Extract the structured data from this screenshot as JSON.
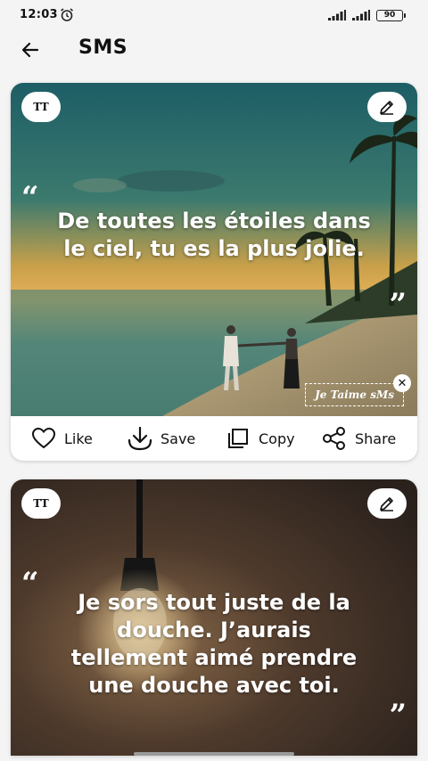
{
  "status_bar": {
    "time": "12:03",
    "battery": "90",
    "icons": [
      "alarm-icon",
      "signal-icon",
      "signal-icon",
      "battery-icon"
    ]
  },
  "header": {
    "title": "SMS",
    "back_icon": "back-arrow-icon"
  },
  "cards": [
    {
      "font_button": "TT",
      "quote_open": "“",
      "quote_close": "”",
      "text": "De toutes les étoiles dans le ciel, tu es la plus jolie.",
      "watermark": "Je Taime sMs",
      "watermark_close": "✕",
      "actions": {
        "like": "Like",
        "save": "Save",
        "copy": "Copy",
        "share": "Share"
      }
    },
    {
      "font_button": "TT",
      "quote_open": "“",
      "quote_close": "”",
      "text": "Je sors tout juste de la douche. J’aurais tellement aimé prendre une douche avec toi."
    }
  ],
  "colors": {
    "background": "#f4f4f4",
    "card": "#ffffff",
    "text": "#111111"
  }
}
